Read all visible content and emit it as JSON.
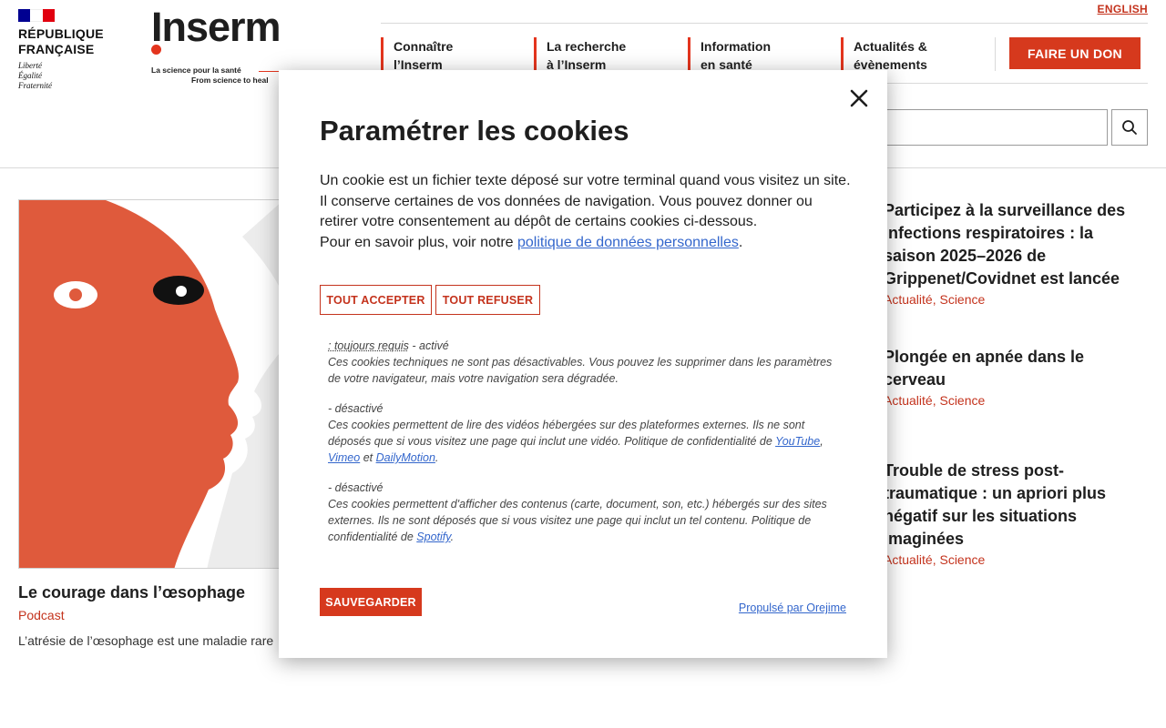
{
  "header": {
    "rf_logo": {
      "lines": [
        "RÉPUBLIQUE",
        "FRANÇAISE"
      ],
      "motto": [
        "Liberté",
        "Égalité",
        "Fraternité"
      ],
      "flag_colors": [
        "#000091",
        "#ffffff",
        "#e1000f"
      ]
    },
    "inserm_logo": {
      "word": "Inserm",
      "tagline_fr": "La science pour la santé",
      "tagline_en": "From science to heal"
    },
    "language_link": "ENGLISH",
    "nav": [
      {
        "label": "Connaître\nl’Inserm"
      },
      {
        "label": "La recherche\nà l’Inserm"
      },
      {
        "label": "Information\nen santé"
      },
      {
        "label": "Actualités &\névènements"
      }
    ],
    "donate_label": "FAIRE UN DON",
    "search_icon": "search-icon"
  },
  "feature": {
    "title": "Le courage dans l’œsophage",
    "category": "Podcast",
    "excerpt": "L’atrésie de l’œsophage est une maladie rare"
  },
  "news": [
    {
      "title": "Participez à la surveillance des infections respiratoires : la saison 2025–2026 de Grippenet/Covidnet est lancée",
      "category": "Actualité, Science"
    },
    {
      "title": "Plongée en apnée dans le cerveau",
      "category": "Actualité, Science"
    },
    {
      "title": "Trouble de stress post-traumatique : un apriori plus négatif sur les situations imaginées",
      "category": "Actualité, Science"
    }
  ],
  "cookie_modal": {
    "title": "Paramétrer les cookies",
    "description": "Un cookie est un fichier texte déposé sur votre terminal quand vous visitez un site. Il conserve certaines de vos données de navigation. Vous pouvez donner ou retirer votre consentement au dépôt de certains cookies ci-dessous.",
    "more_info_prefix": "Pour en savoir plus, voir notre ",
    "more_info_link": "politique de données personnelles",
    "more_info_suffix": ".",
    "accept_all": "TOUT ACCEPTER",
    "refuse_all": "TOUT REFUSER",
    "purposes": [
      {
        "required_label": ": toujours requis",
        "state": " - activé",
        "text": "Ces cookies techniques ne sont pas désactivables. Vous pouvez les supprimer dans les paramètres de votre navigateur, mais votre navigation sera dégradée."
      },
      {
        "state": "- désactivé",
        "text": "Ces cookies permettent de lire des vidéos hébergées sur des plateformes externes. Ils ne sont déposés que si vous visitez une page qui inclut une vidéo. Politique de confidentialité de ",
        "links": [
          "YouTube",
          "Vimeo",
          "DailyMotion"
        ],
        "sep1": ", ",
        "sep2": " et ",
        "end": "."
      },
      {
        "state": "- désactivé",
        "text": "Ces cookies permettent d'afficher des contenus (carte, document, son, etc.) hébergés sur des sites externes. Ils ne sont déposés que si vous visitez une page qui inclut un tel contenu. Politique de confidentialité de ",
        "links": [
          "Spotify"
        ],
        "end": "."
      }
    ],
    "save_label": "SAUVEGARDER",
    "powered_by": "Propulsé par Orejime"
  },
  "colors": {
    "brand_red": "#d6391d",
    "link_blue": "#3366cc",
    "feature_bg": "#df5a3c"
  }
}
